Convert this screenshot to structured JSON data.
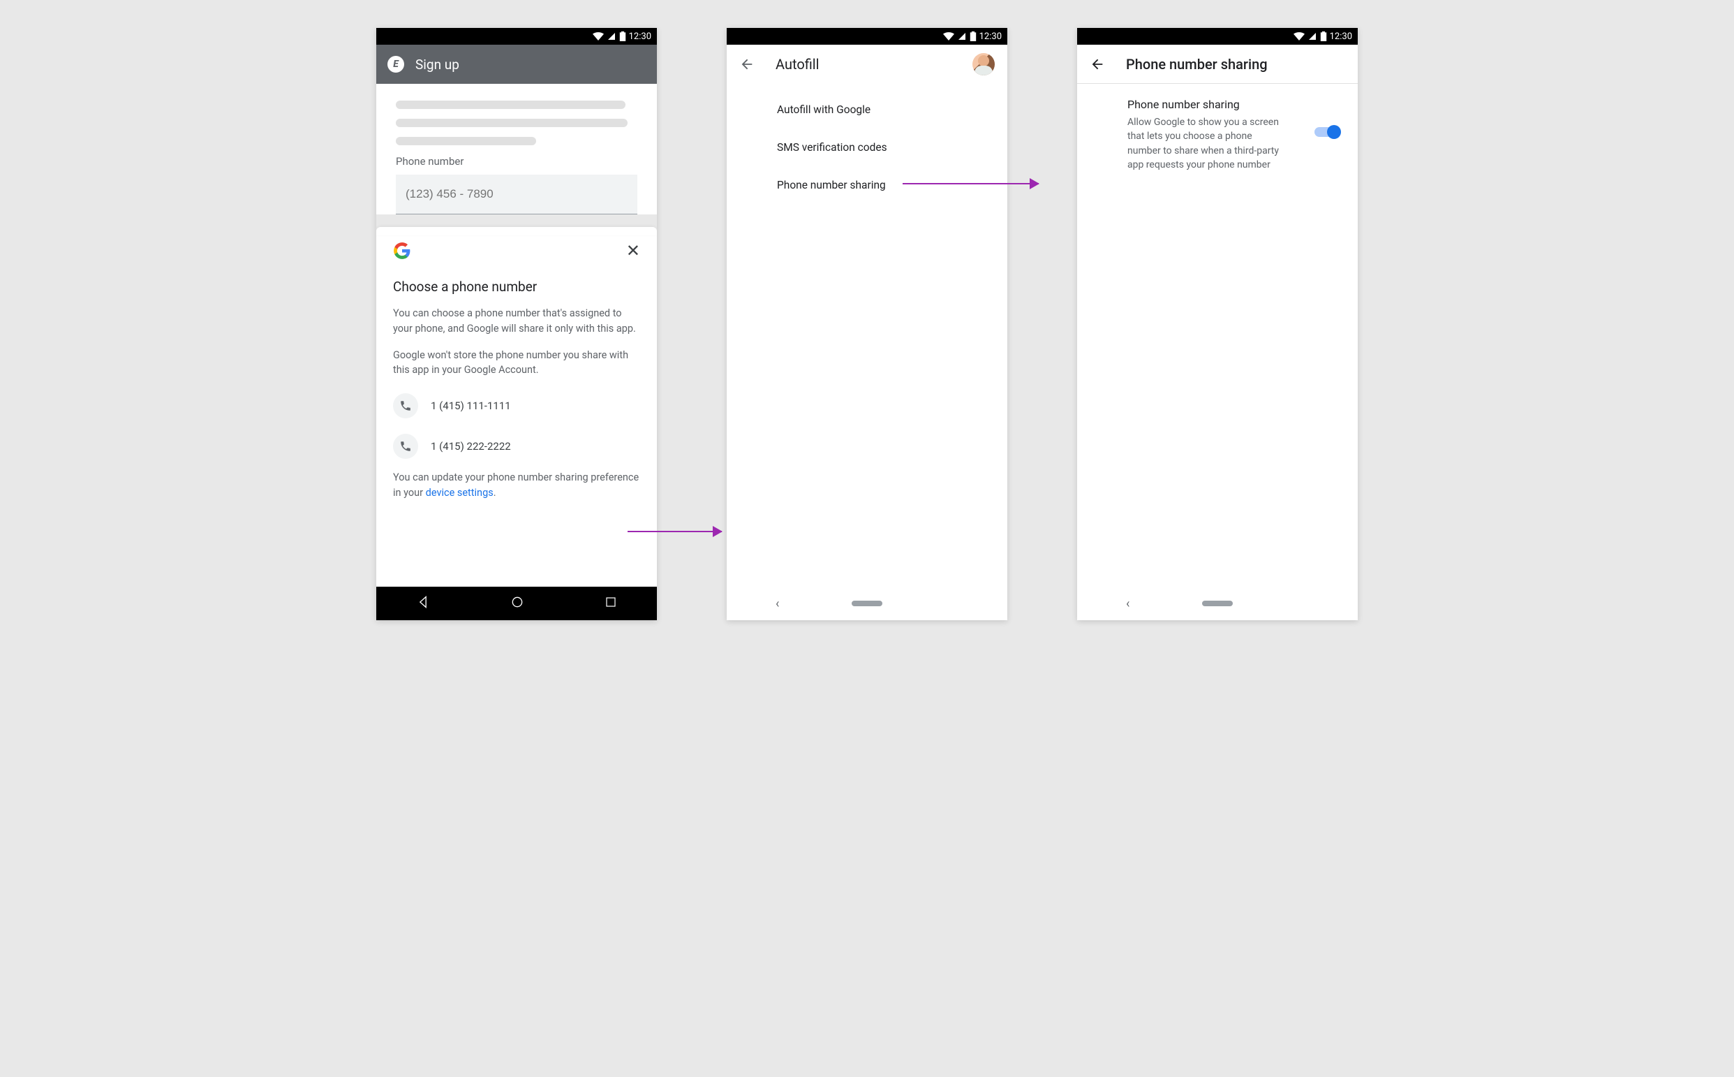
{
  "status": {
    "time": "12:30"
  },
  "screen1": {
    "app_title": "Sign up",
    "app_initial": "E",
    "field_label": "Phone number",
    "input_placeholder": "(123) 456 - 7890",
    "sheet": {
      "title": "Choose a phone number",
      "p1": "You can choose a phone number that's assigned to your phone, and Google will share it only with this app.",
      "p2": "Google won't store the phone number you share with this app in your Google Account.",
      "numbers": [
        "1 (415) 111-1111",
        "1 (415) 222-2222"
      ],
      "p3_pre": "You can update your phone number sharing preference in your ",
      "p3_link": "device settings",
      "p3_post": "."
    }
  },
  "screen2": {
    "title": "Autofill",
    "items": [
      "Autofill with Google",
      "SMS verification codes",
      "Phone number sharing"
    ]
  },
  "screen3": {
    "title": "Phone number sharing",
    "setting_title": "Phone number sharing",
    "setting_desc": "Allow Google to show you a screen that lets you choose a phone number to share when a third-party app requests your phone number"
  }
}
